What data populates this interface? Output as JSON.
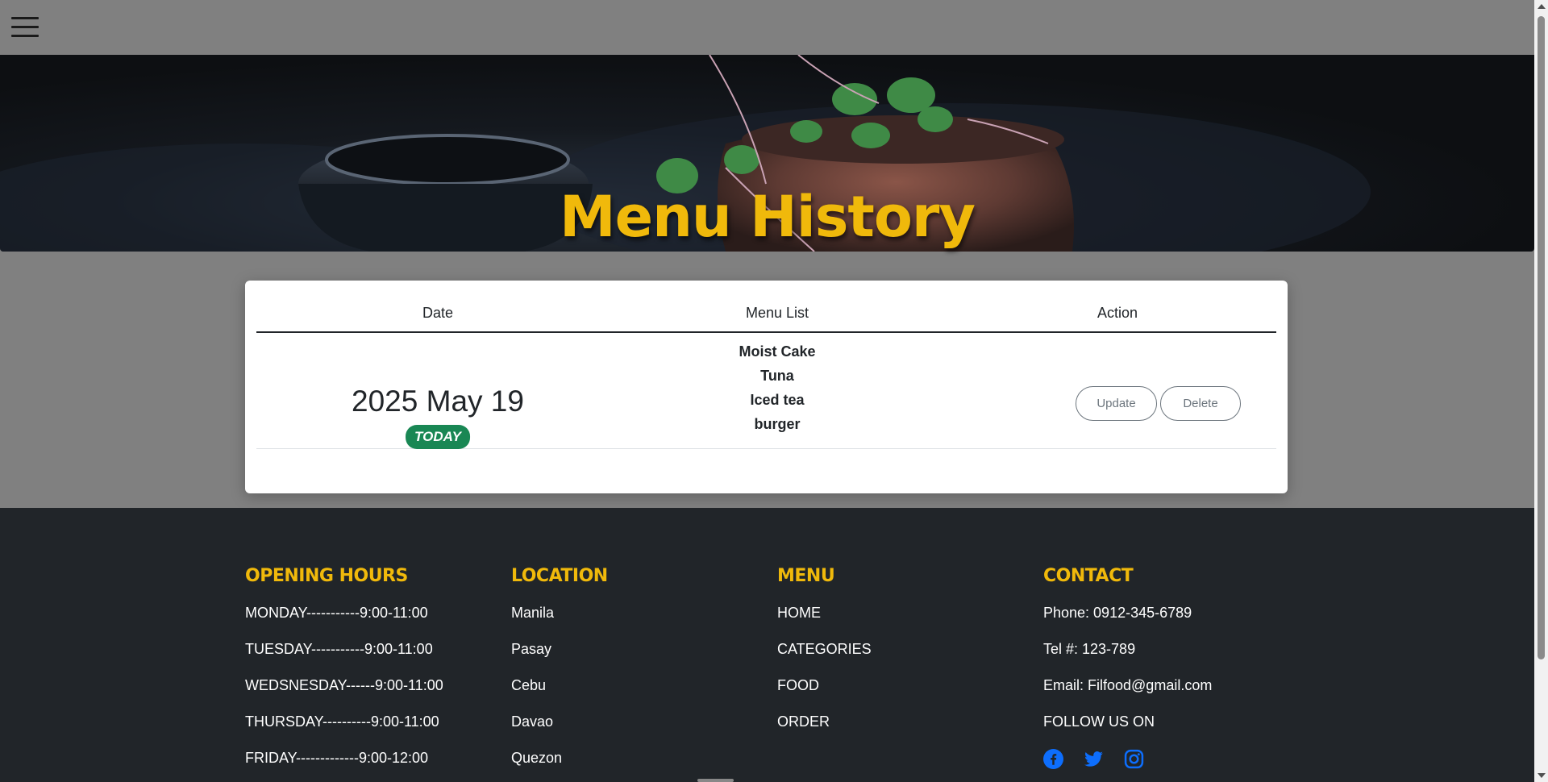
{
  "header": {
    "menu_icon": "hamburger-icon"
  },
  "hero": {
    "title": "Menu History"
  },
  "table": {
    "headers": [
      "Date",
      "Menu List",
      "Action"
    ],
    "rows": [
      {
        "date": "2025 May 19",
        "badge": "TODAY",
        "menu": [
          "Moist Cake",
          "Tuna",
          "Iced tea",
          "burger"
        ],
        "actions": {
          "update": "Update",
          "delete": "Delete"
        }
      }
    ]
  },
  "footer": {
    "hours": {
      "title": "OPENING HOURS",
      "lines": [
        "MONDAY-----------9:00-11:00",
        "TUESDAY-----------9:00-11:00",
        "WEDSNESDAY------9:00-11:00",
        "THURSDAY----------9:00-11:00",
        "FRIDAY-------------9:00-12:00"
      ]
    },
    "location": {
      "title": "LOCATION",
      "lines": [
        "Manila",
        "Pasay",
        "Cebu",
        "Davao",
        "Quezon"
      ]
    },
    "menu": {
      "title": "MENU",
      "lines": [
        "HOME",
        "CATEGORIES",
        "FOOD",
        "ORDER"
      ]
    },
    "contact": {
      "title": "CONTACT",
      "lines": [
        "Phone: 0912-345-6789",
        "Tel #: 123-789",
        "Email: Filfood@gmail.com",
        "FOLLOW US ON"
      ],
      "social_icons": [
        "facebook-icon",
        "twitter-icon",
        "instagram-icon"
      ]
    }
  },
  "colors": {
    "accent": "#f0b90b",
    "footer_bg": "#212529",
    "badge": "#198754",
    "social": "#0d6efd"
  }
}
